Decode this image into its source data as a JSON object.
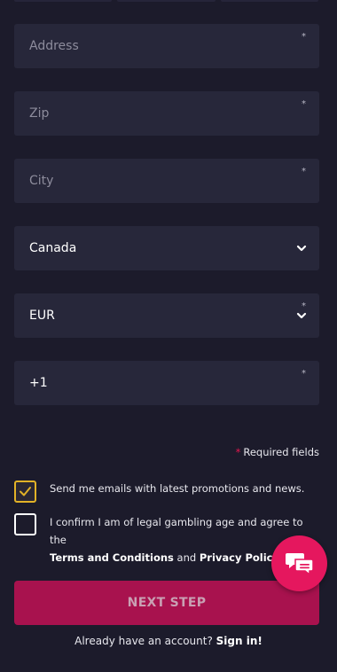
{
  "form": {
    "address_placeholder": "Address",
    "zip_placeholder": "Zip",
    "city_placeholder": "City",
    "country_value": "Canada",
    "currency_value": "EUR",
    "phone_prefix": "+1",
    "required_marker": "*"
  },
  "required_note": {
    "star": "*",
    "text": "Required fields"
  },
  "checkboxes": {
    "emails_label": "Send me emails with latest promotions and news.",
    "emails_checked": true,
    "age_label_prefix": "I confirm I am of legal gambling age and agree to the",
    "terms_link": "Terms and Conditions",
    "and_text": "and",
    "privacy_link": "Privacy Policy",
    "age_checked": false
  },
  "actions": {
    "next_step_label": "NEXT STEP",
    "account_prompt": "Already have an account?",
    "sign_in_link": "Sign in!"
  },
  "colors": {
    "background": "#1c1b2b",
    "field": "#27273a",
    "accent_pink": "#e5175e",
    "button": "#a8124e",
    "checkbox_gold": "#e2b227"
  },
  "icons": {
    "dropdown": "chevron-down-icon",
    "checkmark": "check-icon",
    "chat": "chat-bubbles-icon"
  }
}
